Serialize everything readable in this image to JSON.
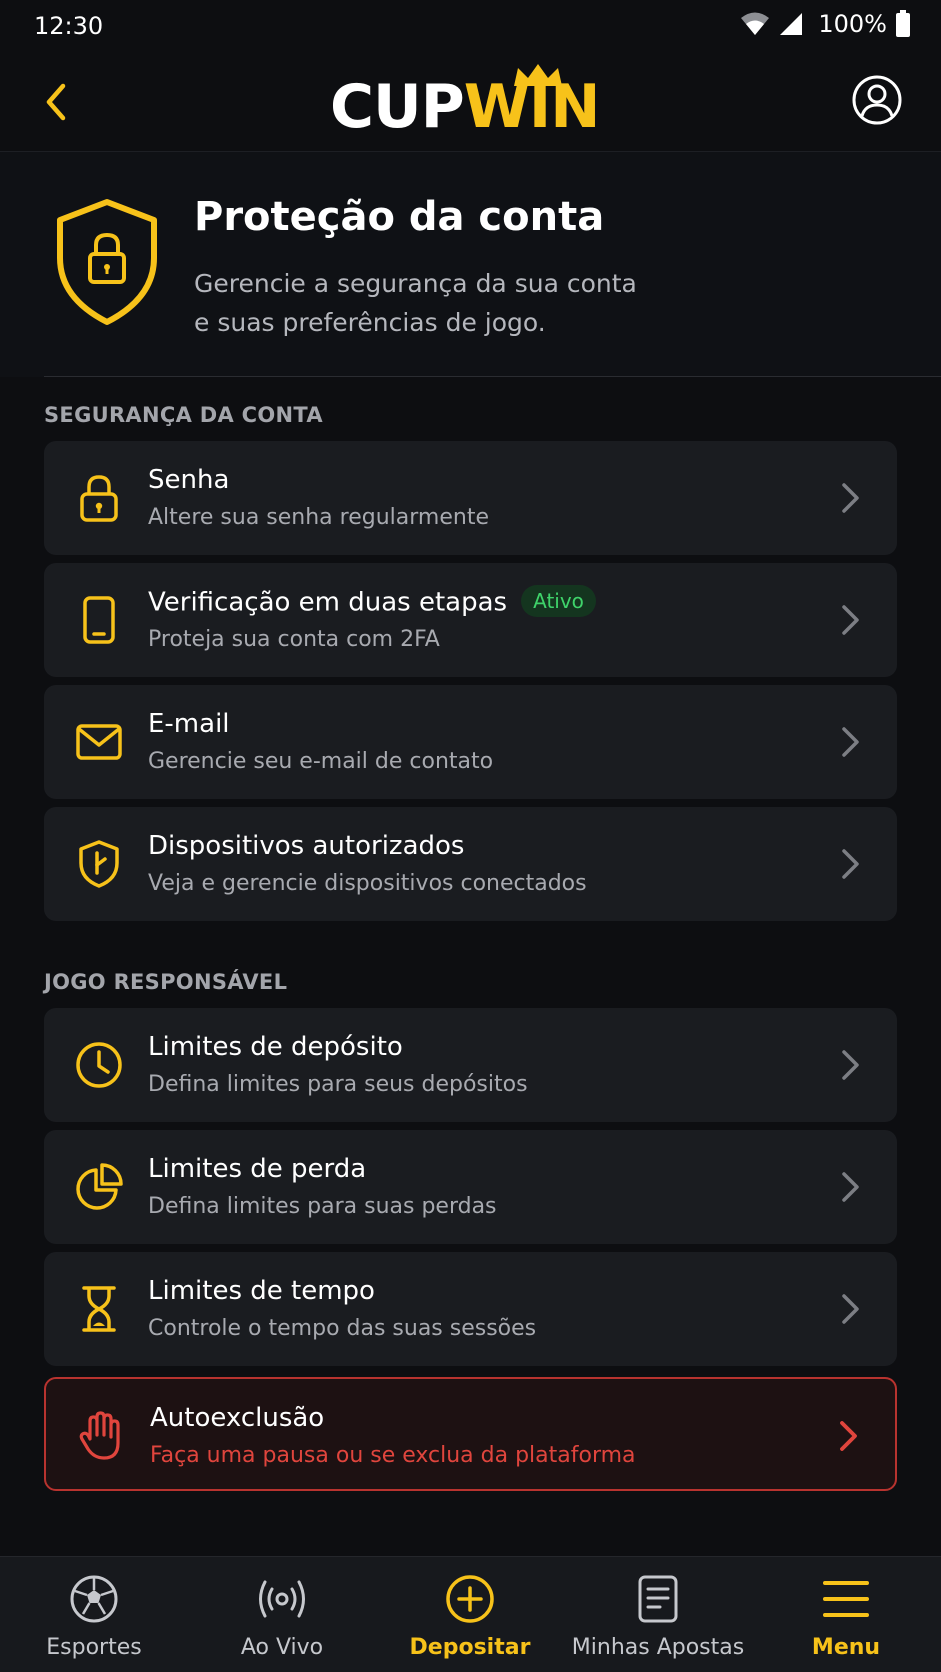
{
  "status_bar": {
    "time": "12:30",
    "battery": "100%"
  },
  "header": {
    "logo_left": "CUP",
    "logo_right": "WIN"
  },
  "hero": {
    "title": "Proteção da conta",
    "subtitle_line1": "Gerencie a segurança da sua conta",
    "subtitle_line2": "e suas preferências de jogo."
  },
  "sections": [
    {
      "label": "SEGURANÇA DA CONTA",
      "items": [
        {
          "title": "Senha",
          "subtitle": "Altere sua senha regularmente",
          "icon": "lock-icon"
        },
        {
          "title": "Verificação em duas etapas",
          "badge": "Ativo",
          "subtitle": "Proteja sua conta com 2FA",
          "icon": "phone-icon"
        },
        {
          "title": "E-mail",
          "subtitle": "Gerencie seu e-mail de contato",
          "icon": "mail-icon"
        },
        {
          "title": "Dispositivos autorizados",
          "subtitle": "Veja e gerencie dispositivos conectados",
          "icon": "shield-key-icon"
        }
      ]
    },
    {
      "label": "JOGO RESPONSÁVEL",
      "items": [
        {
          "title": "Limites de depósito",
          "subtitle": "Defina limites para seus depósitos",
          "icon": "clock-icon"
        },
        {
          "title": "Limites de perda",
          "subtitle": "Defina limites para suas perdas",
          "icon": "pie-chart-icon"
        },
        {
          "title": "Limites de tempo",
          "subtitle": "Controle o tempo das suas sessões",
          "icon": "hourglass-icon"
        },
        {
          "title": "Autoexclusão",
          "subtitle": "Faça uma pausa ou se exclua da plataforma",
          "icon": "hand-icon"
        }
      ]
    }
  ],
  "bottom_nav": [
    {
      "label": "Esportes",
      "icon": "soccer-ball-icon"
    },
    {
      "label": "Ao Vivo",
      "icon": "live-broadcast-icon"
    },
    {
      "label": "Depositar",
      "icon": "plus-circle-icon"
    },
    {
      "label": "Minhas Apostas",
      "icon": "bet-slip-icon"
    },
    {
      "label": "Menu",
      "icon": "menu-icon"
    }
  ],
  "colors": {
    "accent": "#f7c21a",
    "danger": "#e0453d",
    "active_badge": "#3fd36a",
    "background": "#0d0e11",
    "card": "#1a1c20"
  }
}
